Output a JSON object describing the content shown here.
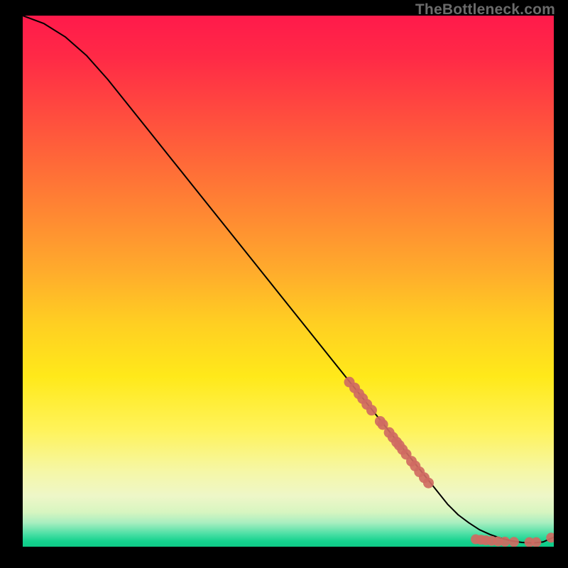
{
  "watermark": "TheBottleneck.com",
  "chart_data": {
    "type": "line",
    "title": "",
    "xlabel": "",
    "ylabel": "",
    "xlim": [
      0,
      100
    ],
    "ylim": [
      0,
      100
    ],
    "grid": false,
    "legend": false,
    "series": [
      {
        "name": "curve",
        "style": "line",
        "color": "#000000",
        "x": [
          0,
          4,
          8,
          12,
          16,
          20,
          24,
          28,
          32,
          36,
          40,
          44,
          48,
          52,
          56,
          60,
          64,
          68,
          72,
          76,
          80,
          82,
          84,
          86,
          88,
          90,
          92,
          94,
          96,
          98,
          100
        ],
        "y": [
          100,
          98.5,
          96,
          92.5,
          88,
          83,
          78,
          73,
          68,
          63,
          58,
          53,
          48,
          43,
          38,
          33,
          28,
          23,
          18,
          13,
          8,
          6,
          4.5,
          3.2,
          2.3,
          1.6,
          1.1,
          0.8,
          0.7,
          0.9,
          1.8
        ]
      },
      {
        "name": "cluster-upper",
        "style": "points",
        "color": "#cf6a62",
        "x": [
          61.5,
          62.5,
          63.3,
          64.0,
          64.8,
          65.7,
          67.3,
          67.8,
          69.0,
          69.7,
          70.4,
          70.9,
          71.5,
          72.2,
          73.2,
          73.9,
          74.7,
          75.6,
          76.4
        ],
        "y": [
          31.0,
          29.9,
          28.8,
          27.9,
          26.8,
          25.7,
          23.6,
          23.0,
          21.5,
          20.6,
          19.7,
          19.1,
          18.3,
          17.4,
          16.1,
          15.2,
          14.1,
          13.0,
          12.0
        ]
      },
      {
        "name": "cluster-lower",
        "style": "points",
        "color": "#cf6a62",
        "x": [
          85.3,
          86.3,
          87.2,
          88.3,
          89.5,
          90.8,
          92.5,
          95.4,
          96.7,
          99.5
        ],
        "y": [
          1.4,
          1.3,
          1.2,
          1.1,
          1.0,
          0.95,
          0.9,
          0.85,
          0.85,
          1.7
        ]
      }
    ],
    "gradient_stops": [
      {
        "offset": 0.0,
        "color": "#ff1a4b"
      },
      {
        "offset": 0.08,
        "color": "#ff2a46"
      },
      {
        "offset": 0.18,
        "color": "#ff4a3f"
      },
      {
        "offset": 0.28,
        "color": "#ff6a38"
      },
      {
        "offset": 0.38,
        "color": "#ff8a32"
      },
      {
        "offset": 0.48,
        "color": "#ffab2c"
      },
      {
        "offset": 0.58,
        "color": "#ffcf22"
      },
      {
        "offset": 0.68,
        "color": "#ffe91a"
      },
      {
        "offset": 0.78,
        "color": "#fff35a"
      },
      {
        "offset": 0.86,
        "color": "#f5f7a8"
      },
      {
        "offset": 0.905,
        "color": "#eef7c8"
      },
      {
        "offset": 0.935,
        "color": "#d7f5c0"
      },
      {
        "offset": 0.955,
        "color": "#a8eec0"
      },
      {
        "offset": 0.975,
        "color": "#4fe0a6"
      },
      {
        "offset": 0.99,
        "color": "#14d28e"
      },
      {
        "offset": 1.0,
        "color": "#0fc987"
      }
    ]
  }
}
